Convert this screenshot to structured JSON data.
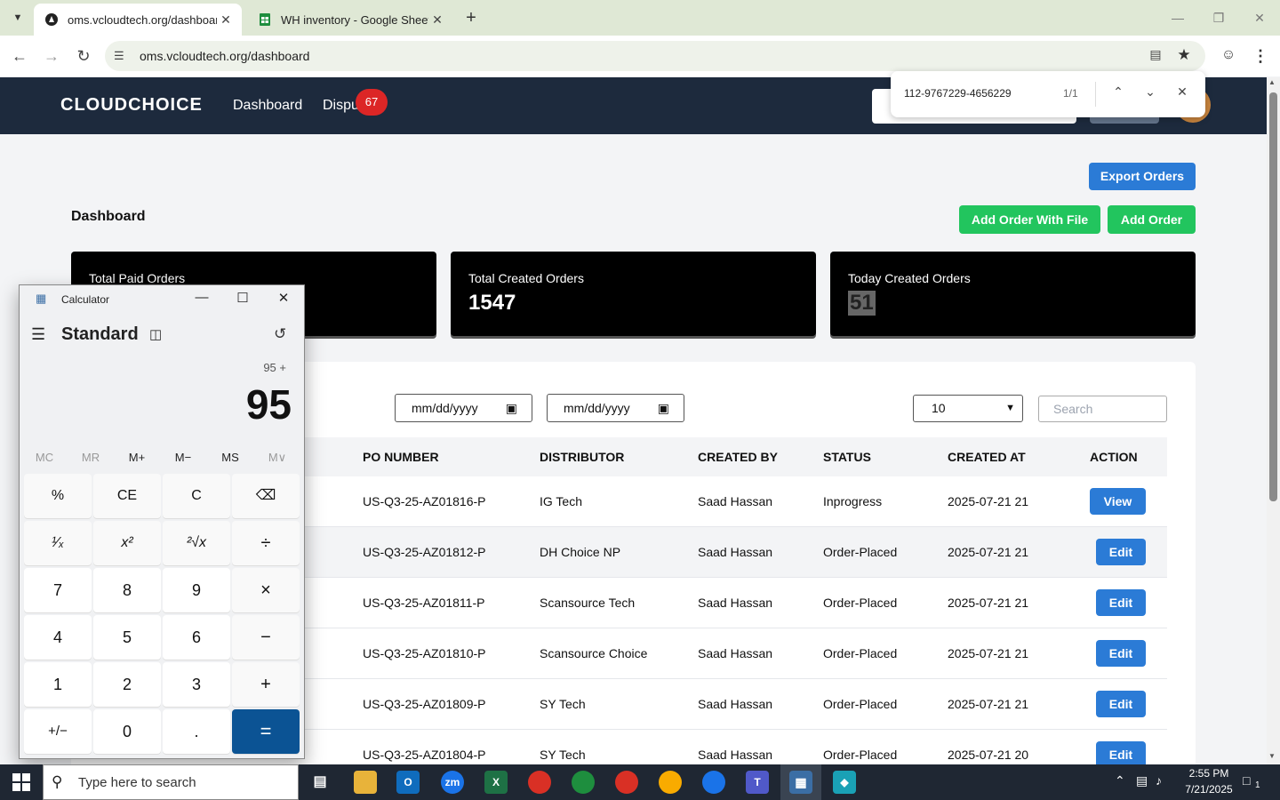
{
  "browser": {
    "tabs": [
      {
        "title": "oms.vcloudtech.org/dashboard",
        "active": true,
        "icon": "site-icon"
      },
      {
        "title": "WH inventory - Google Sheets",
        "active": false,
        "icon": "sheets-icon"
      }
    ],
    "url": "oms.vcloudtech.org/dashboard",
    "find": {
      "query": "112-9767229-4656229",
      "count": "1/1"
    }
  },
  "app": {
    "logo": "CLOUDCHOICE",
    "nav": {
      "dashboard": "Dashboard",
      "disputes": "Dispu",
      "disputes_badge": "67"
    },
    "page_title": "Dashboard",
    "buttons": {
      "export": "Export Orders",
      "add_with_file": "Add Order With File",
      "add_order": "Add Order"
    },
    "stats": [
      {
        "label": "Total Paid Orders",
        "value": ""
      },
      {
        "label": "Total Created Orders",
        "value": "1547"
      },
      {
        "label": "Today Created Orders",
        "value": "51"
      }
    ],
    "filters": {
      "date_from": "mm/dd/yyyy",
      "date_to": "mm/dd/yyyy",
      "per_page": "10",
      "search_placeholder": "Search"
    },
    "table": {
      "columns": [
        "PO NUMBER",
        "DISTRIBUTOR",
        "CREATED BY",
        "STATUS",
        "CREATED AT",
        "ACTION"
      ],
      "rows": [
        {
          "po": "US-Q3-25-AZ01816-P",
          "distributor": "IG Tech",
          "created_by": "Saad Hassan",
          "status": "Inprogress",
          "created_at": "2025-07-21 21",
          "action": "View"
        },
        {
          "po": "US-Q3-25-AZ01812-P",
          "distributor": "DH Choice NP",
          "created_by": "Saad Hassan",
          "status": "Order-Placed",
          "created_at": "2025-07-21 21",
          "action": "Edit"
        },
        {
          "po": "US-Q3-25-AZ01811-P",
          "distributor": "Scansource Tech",
          "created_by": "Saad Hassan",
          "status": "Order-Placed",
          "created_at": "2025-07-21 21",
          "action": "Edit"
        },
        {
          "po": "US-Q3-25-AZ01810-P",
          "distributor": "Scansource Choice",
          "created_by": "Saad Hassan",
          "status": "Order-Placed",
          "created_at": "2025-07-21 21",
          "action": "Edit"
        },
        {
          "po": "US-Q3-25-AZ01809-P",
          "distributor": "SY Tech",
          "created_by": "Saad Hassan",
          "status": "Order-Placed",
          "created_at": "2025-07-21 21",
          "action": "Edit"
        },
        {
          "po": "US-Q3-25-AZ01804-P",
          "distributor": "SY Tech",
          "created_by": "Saad Hassan",
          "status": "Order-Placed",
          "created_at": "2025-07-21 20",
          "action": "Edit"
        }
      ]
    }
  },
  "calculator": {
    "title": "Calculator",
    "mode": "Standard",
    "expression": "95 +",
    "display": "95",
    "memory": [
      "MC",
      "MR",
      "M+",
      "M−",
      "MS",
      "M∨"
    ],
    "keys": [
      [
        "%",
        "CE",
        "C",
        "⌫"
      ],
      [
        "¹⁄ₓ",
        "x²",
        "²√x",
        "÷"
      ],
      [
        "7",
        "8",
        "9",
        "×"
      ],
      [
        "4",
        "5",
        "6",
        "−"
      ],
      [
        "1",
        "2",
        "3",
        "+"
      ],
      [
        "+/−",
        "0",
        ".",
        "="
      ]
    ]
  },
  "taskbar": {
    "search_placeholder": "Type here to search",
    "time": "2:55 PM",
    "date": "7/21/2025",
    "notification_count": "1"
  },
  "colors": {
    "header": "#1d2a3d",
    "primary": "#2b7bd6",
    "success": "#22c55e",
    "badge": "#dc2626",
    "calc_equals": "#0b5394"
  }
}
